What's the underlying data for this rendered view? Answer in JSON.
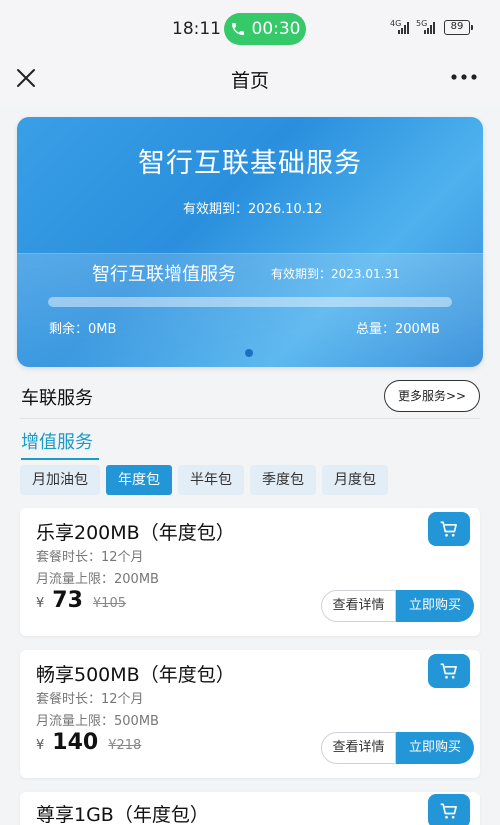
{
  "status_bar": {
    "time": "18:11",
    "call_duration": "00:30",
    "sim1": "4G",
    "sim2": "5G",
    "battery": "89"
  },
  "header": {
    "title": "首页",
    "close_icon": "close-icon",
    "more_icon": "more-dots-icon"
  },
  "banner": {
    "title": "智行互联基础服务",
    "valid_until": "有效期到：2026.10.12",
    "addon_title": "智行互联增值服务",
    "addon_valid_until": "有效期到：2023.01.31",
    "remaining": "剩余：0MB",
    "total": "总量：200MB",
    "usage_used_fraction": 0
  },
  "section": {
    "title": "车联服务",
    "more_button": "更多服务>>",
    "subtitle": "增值服务"
  },
  "tabs": [
    {
      "label": "月加油包",
      "active": false
    },
    {
      "label": "年度包",
      "active": true
    },
    {
      "label": "半年包",
      "active": false
    },
    {
      "label": "季度包",
      "active": false
    },
    {
      "label": "月度包",
      "active": false
    }
  ],
  "products": [
    {
      "title": "乐享200MB（年度包）",
      "duration": "套餐时长：12个月",
      "limit": "月流量上限：200MB",
      "currency": "¥",
      "price": "73",
      "old_price": "¥105",
      "detail_button": "查看详情",
      "buy_button": "立即购买"
    },
    {
      "title": "畅享500MB（年度包）",
      "duration": "套餐时长：12个月",
      "limit": "月流量上限：500MB",
      "currency": "¥",
      "price": "140",
      "old_price": "¥218",
      "detail_button": "查看详情",
      "buy_button": "立即购买"
    },
    {
      "title": "尊享1GB（年度包）"
    }
  ],
  "colors": {
    "accent": "#2296d6",
    "call_green": "#36c96a",
    "subtitle_teal": "#1a9bc8"
  }
}
